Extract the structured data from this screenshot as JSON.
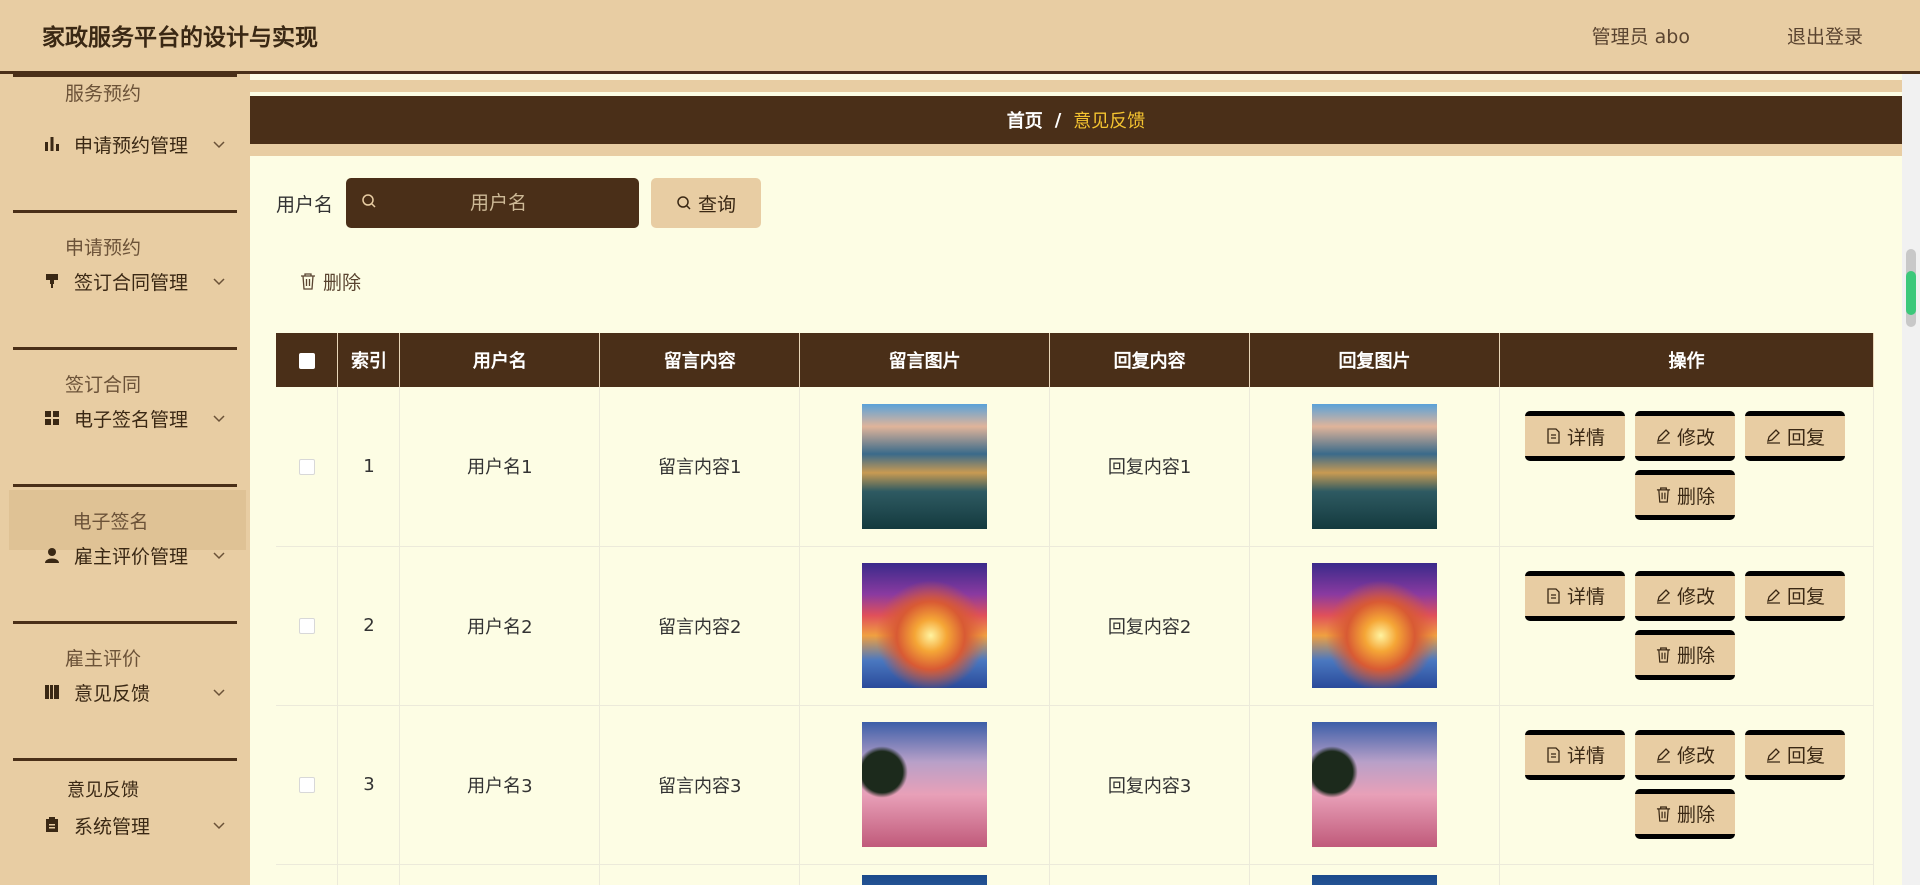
{
  "header": {
    "title": "家政服务平台的设计与实现",
    "user": "管理员 abo",
    "logout": "退出登录"
  },
  "sidebar": {
    "top_sub": "服务预约",
    "menus": [
      {
        "label": "申请预约管理",
        "icon": "bar-chart-icon",
        "sub": "申请预约"
      },
      {
        "label": "签订合同管理",
        "icon": "contract-icon",
        "sub": "签订合同"
      },
      {
        "label": "电子签名管理",
        "icon": "grid-icon",
        "sub": "电子签名"
      },
      {
        "label": "雇主评价管理",
        "icon": "user-icon",
        "sub": "雇主评价"
      },
      {
        "label": "意见反馈",
        "icon": "book-icon",
        "sub": "意见反馈"
      },
      {
        "label": "系统管理",
        "icon": "clipboard-icon",
        "sub": ""
      }
    ],
    "active_sub": "电子签名"
  },
  "breadcrumb": {
    "home": "首页",
    "separator": "/",
    "current": "意见反馈"
  },
  "search": {
    "label": "用户名",
    "placeholder": "用户名",
    "button": "查询"
  },
  "toolbar": {
    "delete": "删除"
  },
  "table": {
    "headers": [
      "索引",
      "用户名",
      "留言内容",
      "留言图片",
      "回复内容",
      "回复图片",
      "操作"
    ],
    "rows": [
      {
        "index": "1",
        "username": "用户名1",
        "message": "留言内容1",
        "reply": "回复内容1"
      },
      {
        "index": "2",
        "username": "用户名2",
        "message": "留言内容2",
        "reply": "回复内容2"
      },
      {
        "index": "3",
        "username": "用户名3",
        "message": "留言内容3",
        "reply": "回复内容3"
      }
    ],
    "actions": {
      "detail": "详情",
      "edit": "修改",
      "reply": "回复",
      "delete": "删除"
    }
  },
  "colors": {
    "primary_dark": "#4a2f18",
    "accent_tan": "#e8cda3",
    "page_bg": "#fdfde4",
    "breadcrumb_current": "#f5c430"
  }
}
